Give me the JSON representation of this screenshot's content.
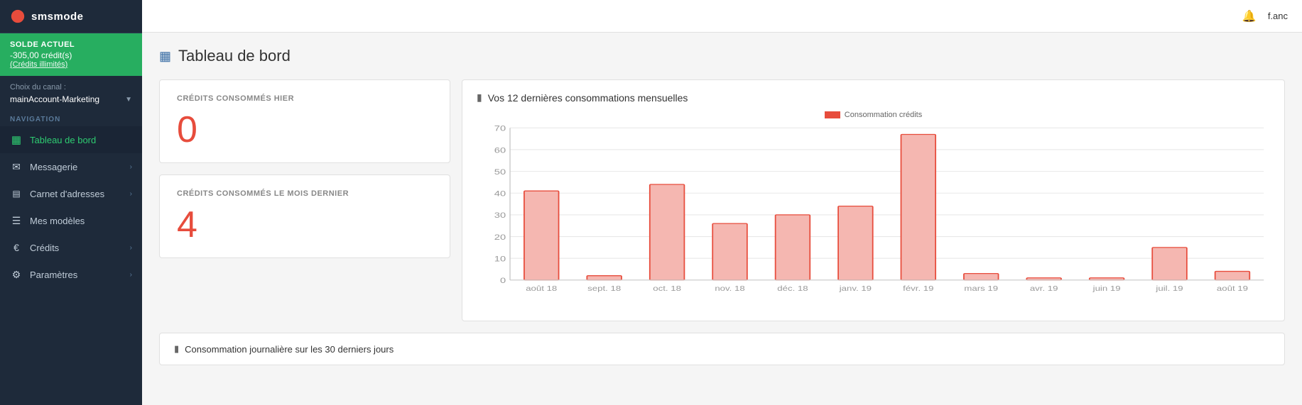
{
  "sidebar": {
    "logo": {
      "text": "smsmode"
    },
    "balance": {
      "label": "SOLDE ACTUEL",
      "value": "-305,00 crédit(s)",
      "sub_prefix": "(Crédits ",
      "sub_highlight": "illimités",
      "sub_suffix": ")"
    },
    "channel": {
      "label": "Choix du canal :",
      "value": "mainAccount-Marketing"
    },
    "nav_label": "NAVIGATION",
    "nav_items": [
      {
        "id": "tableau-de-bord",
        "label": "Tableau de bord",
        "icon": "▦",
        "active": true,
        "has_arrow": false
      },
      {
        "id": "messagerie",
        "label": "Messagerie",
        "icon": "✉",
        "active": false,
        "has_arrow": true
      },
      {
        "id": "carnet-adresses",
        "label": "Carnet d'adresses",
        "icon": "📋",
        "active": false,
        "has_arrow": true
      },
      {
        "id": "mes-modeles",
        "label": "Mes modèles",
        "icon": "☰",
        "active": false,
        "has_arrow": false
      },
      {
        "id": "credits",
        "label": "Crédits",
        "icon": "€",
        "active": false,
        "has_arrow": true
      },
      {
        "id": "parametres",
        "label": "Paramètres",
        "icon": "⚙",
        "active": false,
        "has_arrow": true
      }
    ]
  },
  "header": {
    "user": "f.anc",
    "notification_icon": "🔔"
  },
  "page": {
    "title": "Tableau de bord",
    "title_icon": "▦"
  },
  "cards": {
    "yesterday": {
      "label": "CRÉDITS CONSOMMÉS HIER",
      "value": "0"
    },
    "last_month": {
      "label": "CRÉDITS CONSOMMÉS LE MOIS DERNIER",
      "value": "4"
    }
  },
  "monthly_chart": {
    "title": "Vos 12 dernières consommations mensuelles",
    "legend": "Consommation crédits",
    "months": [
      "août 18",
      "sept. 18",
      "oct. 18",
      "nov. 18",
      "déc. 18",
      "janv. 19",
      "févr. 19",
      "mars 19",
      "avr. 19",
      "juin 19",
      "juil. 19",
      "août 19"
    ],
    "values": [
      41,
      2,
      44,
      26,
      30,
      34,
      67,
      3,
      1,
      1,
      15,
      4
    ],
    "y_max": 70,
    "y_ticks": [
      0,
      10,
      20,
      30,
      40,
      50,
      60,
      70
    ]
  },
  "bottom_chart": {
    "title": "Consommation journalière sur les 30 derniers jours",
    "icon": "▦"
  },
  "colors": {
    "bar_fill": "#f5b7b1",
    "bar_stroke": "#e74c3c",
    "grid_line": "#e8e8e8",
    "axis_text": "#999"
  }
}
